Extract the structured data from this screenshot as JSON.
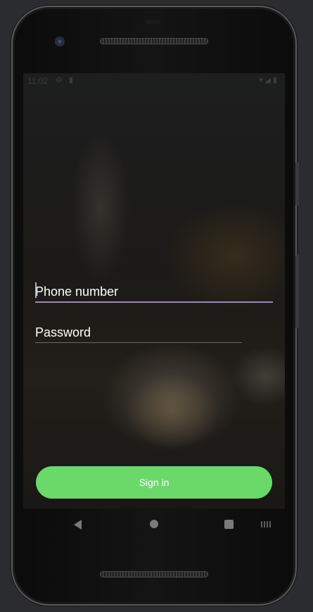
{
  "status_bar": {
    "time": "11:02",
    "icons_left": "⚙ ▮",
    "icons_right": "▾◢▮"
  },
  "form": {
    "phone_label": "Phone number",
    "password_label": "Password",
    "accent_color": "#9b8ab0"
  },
  "signin": {
    "label": "Sign in",
    "color": "#6ad96a"
  },
  "nav": {
    "back_icon": "back-triangle-icon",
    "home_icon": "home-circle-icon",
    "recents_icon": "recents-square-icon",
    "keyboard_icon": "keyboard-icon"
  }
}
